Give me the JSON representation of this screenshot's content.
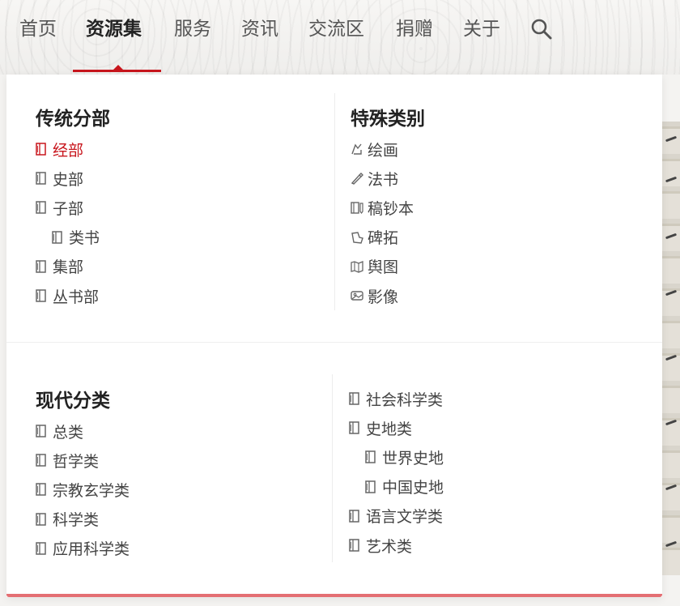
{
  "nav": {
    "items": [
      "首页",
      "资源集",
      "服务",
      "资讯",
      "交流区",
      "捐赠",
      "关于"
    ],
    "active_index": 1
  },
  "colors": {
    "accent": "#c8161d",
    "text": "#444444",
    "title": "#222222"
  },
  "traditional": {
    "title": "传统分部",
    "items": [
      {
        "label": "经部",
        "icon": "book-icon",
        "active": true
      },
      {
        "label": "史部",
        "icon": "book-icon"
      },
      {
        "label": "子部",
        "icon": "book-icon"
      },
      {
        "label": "类书",
        "icon": "book-icon",
        "indent": true
      },
      {
        "label": "集部",
        "icon": "book-icon"
      },
      {
        "label": "丛书部",
        "icon": "book-icon"
      }
    ]
  },
  "special": {
    "title": "特殊类别",
    "items": [
      {
        "label": "绘画",
        "icon": "painting-icon"
      },
      {
        "label": "法书",
        "icon": "brush-icon"
      },
      {
        "label": "稿钞本",
        "icon": "manuscript-icon"
      },
      {
        "label": "碑拓",
        "icon": "rubbing-icon"
      },
      {
        "label": "舆图",
        "icon": "map-icon"
      },
      {
        "label": "影像",
        "icon": "image-icon"
      }
    ]
  },
  "modern": {
    "title": "现代分类",
    "left_items": [
      {
        "label": "总类",
        "icon": "book-icon"
      },
      {
        "label": "哲学类",
        "icon": "book-icon"
      },
      {
        "label": "宗教玄学类",
        "icon": "book-icon"
      },
      {
        "label": "科学类",
        "icon": "book-icon"
      },
      {
        "label": "应用科学类",
        "icon": "book-icon"
      }
    ],
    "right_items": [
      {
        "label": "社会科学类",
        "icon": "book-icon"
      },
      {
        "label": "史地类",
        "icon": "book-icon"
      },
      {
        "label": "世界史地",
        "icon": "book-icon",
        "indent": true
      },
      {
        "label": "中国史地",
        "icon": "book-icon",
        "indent": true
      },
      {
        "label": "语言文学类",
        "icon": "book-icon"
      },
      {
        "label": "艺术类",
        "icon": "book-icon"
      }
    ]
  }
}
